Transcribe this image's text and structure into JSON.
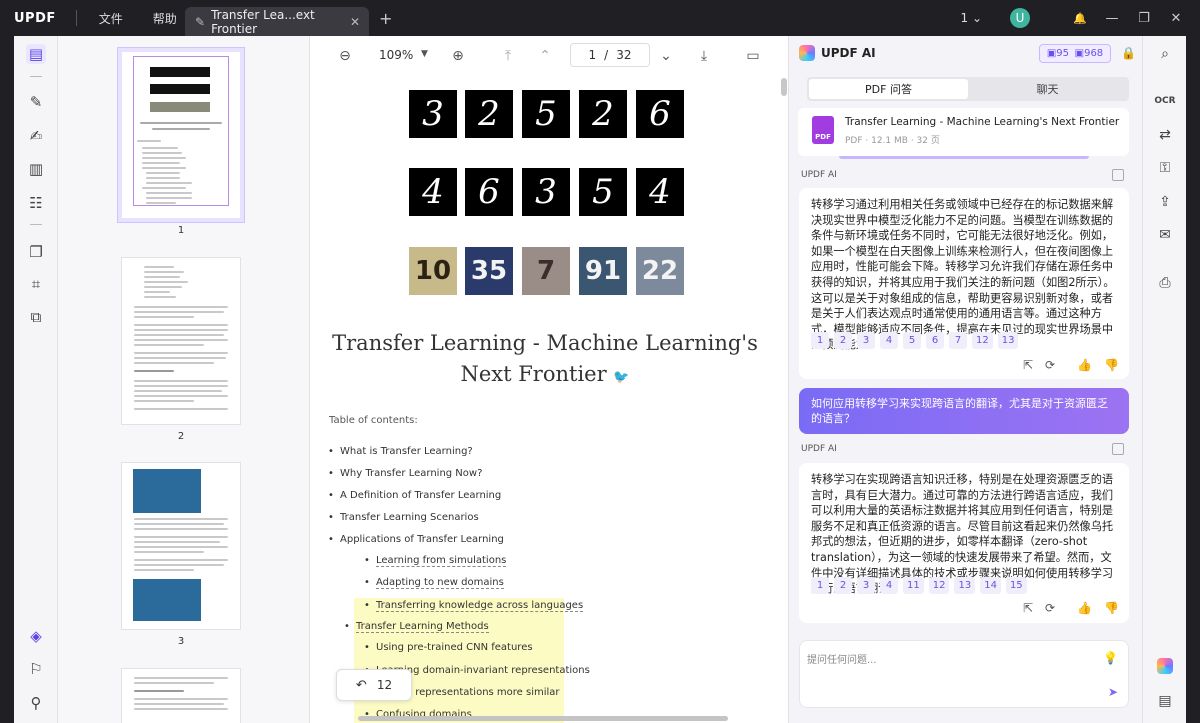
{
  "app": {
    "logo": "UPDF",
    "menu_file": "文件",
    "menu_help": "帮助"
  },
  "tab": {
    "title": "Transfer Lea...ext Frontier",
    "close": "✕",
    "new": "+"
  },
  "titlebar": {
    "page_selector": "1",
    "user_initial": "U",
    "btn_bell": "🔔",
    "btn_minimize": "—",
    "btn_restore": "❐",
    "btn_close": "✕"
  },
  "toolbar": {
    "zoom": "109%",
    "page_current": "1",
    "page_sep": "/",
    "page_total": "32"
  },
  "thumbnails": [
    {
      "page": "1"
    },
    {
      "page": "2"
    },
    {
      "page": "3"
    }
  ],
  "document": {
    "digits_row1": [
      "3",
      "2",
      "5",
      "2",
      "6"
    ],
    "digits_row2": [
      "4",
      "6",
      "3",
      "5",
      "4"
    ],
    "svhn_row": [
      "10",
      "35",
      "7",
      "91",
      "22"
    ],
    "title_line1": "Transfer Learning - Machine Learning's",
    "title_line2": "Next Frontier",
    "toc_heading": "Table of contents:",
    "toc": [
      "What is Transfer Learning?",
      "Why Transfer Learning Now?",
      "A Definition of Transfer Learning",
      "Transfer Learning Scenarios",
      "Applications of Transfer Learning",
      "Learning from simulations",
      "Adapting to new domains",
      "Transferring knowledge across languages",
      "Transfer Learning Methods",
      "Using pre-trained CNN features",
      "Learning domain-invariant representations",
      "Making representations more similar",
      "Confusing domains"
    ],
    "back_count": "12"
  },
  "ai_panel": {
    "title": "UPDF AI",
    "credits_a": "95",
    "credits_b": "968",
    "tab_pdf": "PDF 问答",
    "tab_chat": "聊天",
    "file_name": "Transfer Learning - Machine Learning's Next Frontier",
    "file_meta": "PDF · 12.1 MB · 32 页",
    "label_ai": "UPDF AI",
    "answer1": "转移学习通过利用相关任务或领域中已经存在的标记数据来解决现实世界中模型泛化能力不足的问题。当模型在训练数据的条件与新环境或任务不同时，它可能无法很好地泛化。例如，如果一个模型在白天图像上训练来检测行人，但在夜间图像上应用时，性能可能会下降。转移学习允许我们存储在源任务中获得的知识，并将其应用于我们关注的新问题（如图2所示）。这可以是关于对象组成的信息，帮助更容易识别新对象，或者是关于人们表达观点时通常使用的通用语言等。通过这种方式，模型能够适应不同条件，提高在未见过的现实世界场景中的预测能力。",
    "refs1": [
      "1",
      "2",
      "3",
      "4",
      "5",
      "6",
      "7",
      "12",
      "13"
    ],
    "question": "如何应用转移学习来实现跨语言的翻译，尤其是对于资源匮乏的语言？",
    "answer2": "转移学习在实现跨语言知识迁移，特别是在处理资源匮乏的语言时，具有巨大潜力。通过可靠的方法进行跨语言适应，我们可以利用大量的英语标注数据并将其应用到任何语言，特别是服务不足和真正低资源的语言。尽管目前这看起来仍然像乌托邦式的想法，但近期的进步，如零样本翻译（zero-shot translation），为这一领域的快速发展带来了希望。然而，文件中没有详细描述具体的技术或步骤来说明如何使用转移学习进行跨语言翻译。",
    "refs2": [
      "1",
      "2",
      "3",
      "4",
      "11",
      "12",
      "13",
      "14",
      "15"
    ],
    "input_placeholder": "提问任何问题..."
  }
}
